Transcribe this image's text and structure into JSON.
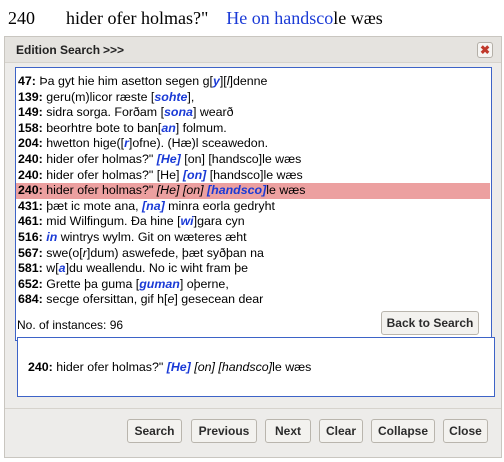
{
  "header": {
    "line_number": "240",
    "text_before": "hider ofer holmas?\"",
    "text_highlight": "He on handsco",
    "text_after": "le wæs"
  },
  "dialog": {
    "title": "Edition Search",
    "toggle_label": ">>>",
    "close_icon": "close-icon",
    "close_symbol": "✖"
  },
  "results": [
    {
      "num": "47:",
      "parts": [
        {
          "t": " Þa gyt hie him asetton segen g["
        },
        {
          "t": "y",
          "s": "em"
        },
        {
          "t": "]["
        },
        {
          "t": "l",
          "s": "emi"
        },
        {
          "t": "]denne"
        }
      ]
    },
    {
      "num": "139:",
      "parts": [
        {
          "t": " geru(m)licor ræste ["
        },
        {
          "t": "sohte",
          "s": "em"
        },
        {
          "t": "],"
        }
      ]
    },
    {
      "num": "149:",
      "parts": [
        {
          "t": " sidra sorga. Forðam ["
        },
        {
          "t": "sona",
          "s": "em"
        },
        {
          "t": "] wearð"
        }
      ]
    },
    {
      "num": "158:",
      "parts": [
        {
          "t": " beorhtre bote to ban["
        },
        {
          "t": "an",
          "s": "em"
        },
        {
          "t": "] folmum."
        }
      ]
    },
    {
      "num": "204:",
      "parts": [
        {
          "t": " hwetton hige(["
        },
        {
          "t": "r",
          "s": "em"
        },
        {
          "t": "]ofne). (Hæ)l sceawedon."
        }
      ]
    },
    {
      "num": "240:",
      "parts": [
        {
          "t": " hider ofer holmas?\" "
        },
        {
          "t": "[He]",
          "s": "em"
        },
        {
          "t": " [on] [handsco]le wæs"
        }
      ]
    },
    {
      "num": "240:",
      "parts": [
        {
          "t": " hider ofer holmas?\" [He] "
        },
        {
          "t": "[on]",
          "s": "em"
        },
        {
          "t": " [handsco]le wæs"
        }
      ]
    },
    {
      "num": "240:",
      "selected": true,
      "parts": [
        {
          "t": " hider ofer holmas?\" "
        },
        {
          "t": "[He]",
          "s": "emi"
        },
        {
          "t": " "
        },
        {
          "t": "[on]",
          "s": "emi"
        },
        {
          "t": " "
        },
        {
          "t": "[handsco]",
          "s": "em"
        },
        {
          "t": "le wæs"
        }
      ]
    },
    {
      "num": "431:",
      "parts": [
        {
          "t": " þæt ic mote ana, "
        },
        {
          "t": "[na]",
          "s": "em"
        },
        {
          "t": " minra eorla gedryht"
        }
      ]
    },
    {
      "num": "461:",
      "parts": [
        {
          "t": " mid Wilfingum. Ða hine ["
        },
        {
          "t": "wi",
          "s": "em"
        },
        {
          "t": "]gara cyn"
        }
      ]
    },
    {
      "num": "516:",
      "parts": [
        {
          "t": " "
        },
        {
          "t": "in",
          "s": "em"
        },
        {
          "t": " wintrys wylm. Git on wæteres æht"
        }
      ]
    },
    {
      "num": "567:",
      "parts": [
        {
          "t": " swe(o["
        },
        {
          "t": "r",
          "s": "emi"
        },
        {
          "t": "]dum) aswefede, þæt syðþan na"
        }
      ]
    },
    {
      "num": "581:",
      "parts": [
        {
          "t": " w["
        },
        {
          "t": "a",
          "s": "em"
        },
        {
          "t": "]du weallendu. No ic wiht fram þe"
        }
      ]
    },
    {
      "num": "652:",
      "parts": [
        {
          "t": " Grette þa guma ["
        },
        {
          "t": "guman",
          "s": "em"
        },
        {
          "t": "] oþerne,"
        }
      ]
    },
    {
      "num": "684:",
      "parts": [
        {
          "t": " secge ofersittan, gif h["
        },
        {
          "t": "e",
          "s": "emi"
        },
        {
          "t": "] gesecean dear"
        }
      ]
    }
  ],
  "count_label": "No. of instances: 96",
  "back_label": "Back to Search",
  "detail": {
    "num": "240:",
    "parts": [
      {
        "t": " hider ofer holmas?\" "
      },
      {
        "t": "[He]",
        "s": "em"
      },
      {
        "t": " "
      },
      {
        "t": "[on]",
        "s": "emi"
      },
      {
        "t": " "
      },
      {
        "t": "[handsco]",
        "s": "emi"
      },
      {
        "t": "le wæs"
      }
    ]
  },
  "buttons": {
    "search": "Search",
    "previous": "Previous",
    "next": "Next",
    "clear": "Clear",
    "collapse": "Collapse",
    "close": "Close"
  },
  "colors": {
    "highlight_blue": "#1a3ad6",
    "selected_row": "#eca0a0",
    "panel_border": "#3d63c7",
    "dialog_bg": "#edecea"
  }
}
